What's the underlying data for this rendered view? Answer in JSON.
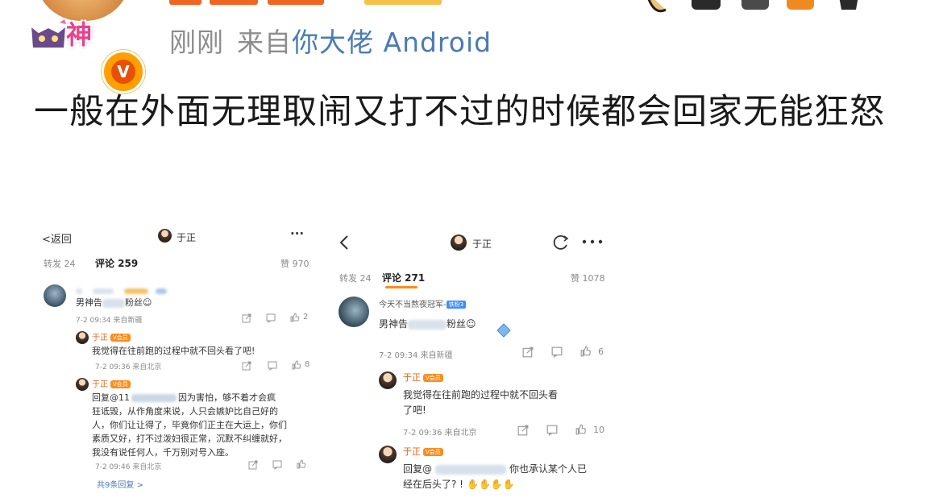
{
  "post": {
    "timestamp": "刚刚",
    "from_prefix": "来自",
    "source": "你大佬 Android",
    "avatar_badge": "神",
    "verified_mark": "V",
    "text": "一般在外面无理取闹又打不过的时候都会回家无能狂怒"
  },
  "shot1": {
    "back_label": "返回",
    "title": "于正",
    "more": "···",
    "repost": "转发 24",
    "comments_tab": "评论 259",
    "likes": "赞 970",
    "c1_text_prefix": "男神告",
    "c1_text_suffix": "粉丝",
    "c1_meta": "7-2 09:34 来自新疆",
    "c1_like": "2",
    "r1_user": "于正",
    "r1_badge": "V会员",
    "r1_text": "我觉得在往前跑的过程中就不回头看了吧!",
    "r1_meta": "7-2 09:36 来自北京",
    "r1_like": "8",
    "r2_user": "于正",
    "r2_badge": "V会员",
    "r2_line1_a": "回复@11",
    "r2_line1_b": "因为害怕，够不着才会疯",
    "r2_line2_a": "狂诋毁，从",
    "r2_line2_b": "作角度来说，人只会嫉妒比自己好的",
    "r2_line3": "人，你们让让得了，毕竟你们正主在大运上，你们",
    "r2_line4": "素质又好，打不过泼妇很正常，沉默不纠缠就好，",
    "r2_line5": "我没有说任何人，千万别对号入座。",
    "r2_meta": "7-2 09:46 来自北京",
    "more_replies": "共9条回复 >"
  },
  "shot2": {
    "title": "于正",
    "repost": "转发 24",
    "comments_tab": "评论 271",
    "likes": "赞 1078",
    "c1_user": "今天不当熬夜冠军-",
    "c1_badge": "铁粉3",
    "c1_text_prefix": "男神告",
    "c1_text_suffix": "粉丝",
    "c1_meta": "7-2 09:34 来自新疆",
    "c1_like": "6",
    "r1_user": "于正",
    "r1_badge": "V会员",
    "r1_line1": "我觉得在往前跑的过程中就不回头看",
    "r1_line2": "了吧!",
    "r1_meta": "7-2 09:36 来自北京",
    "r1_like": "10",
    "r2_user": "于正",
    "r2_badge": "V会员",
    "r2_line1_a": "回复@",
    "r2_line1_b": "你也承认某个人已",
    "r2_line2": "经在后头了? !"
  },
  "colors": {
    "meta_grey": "#8d8d8d",
    "source_blue": "#4a7bb5",
    "accent_orange": "#ff8c1a",
    "username_orange": "#e6671f"
  }
}
